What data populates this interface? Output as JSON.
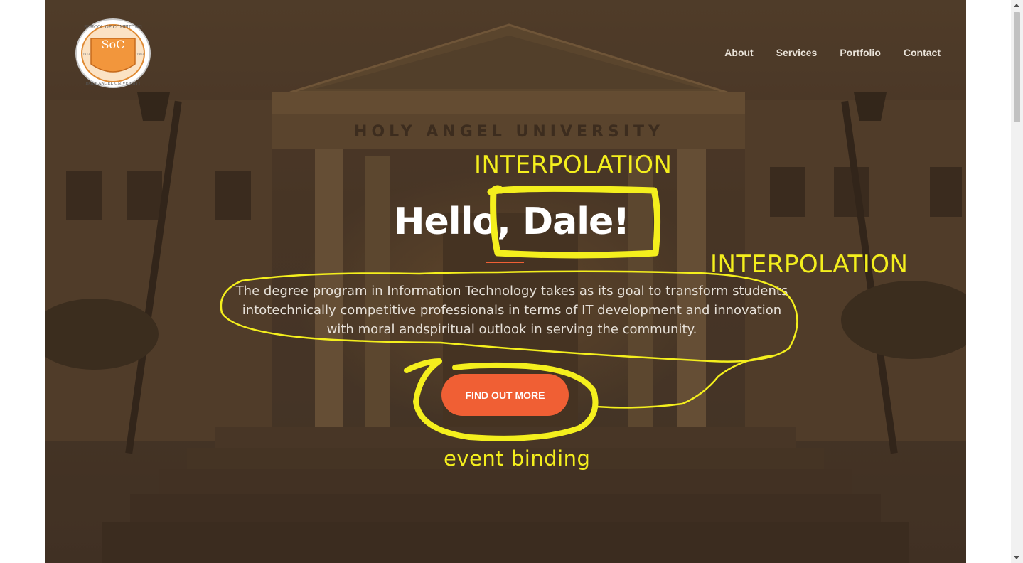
{
  "logo": {
    "initials": "SoC",
    "ring_top": "SCHOOL OF COMPUTING",
    "ring_bottom": "HOLY ANGEL UNIVERSITY",
    "year_left": "1933",
    "year_right": "1993"
  },
  "nav": {
    "items": [
      {
        "label": "About"
      },
      {
        "label": "Services"
      },
      {
        "label": "Portfolio"
      },
      {
        "label": "Contact"
      }
    ]
  },
  "hero": {
    "building_sign": "HOLY ANGEL UNIVERSITY",
    "headline": "Hello, Dale!",
    "lead": "The degree program in Information Technology takes as its goal to transform students intotechnically competitive professionals in terms of IT development and innovation with moral andspiritual outlook in serving the community.",
    "cta_label": "FIND OUT MORE"
  },
  "annotations": {
    "label_1": "INTERPOLATION",
    "label_2": "INTERPOLATION",
    "label_3": "event binding"
  },
  "colors": {
    "accent": "#f05f34",
    "annotation": "#f4ef1d",
    "hero_text": "#ffffff"
  }
}
